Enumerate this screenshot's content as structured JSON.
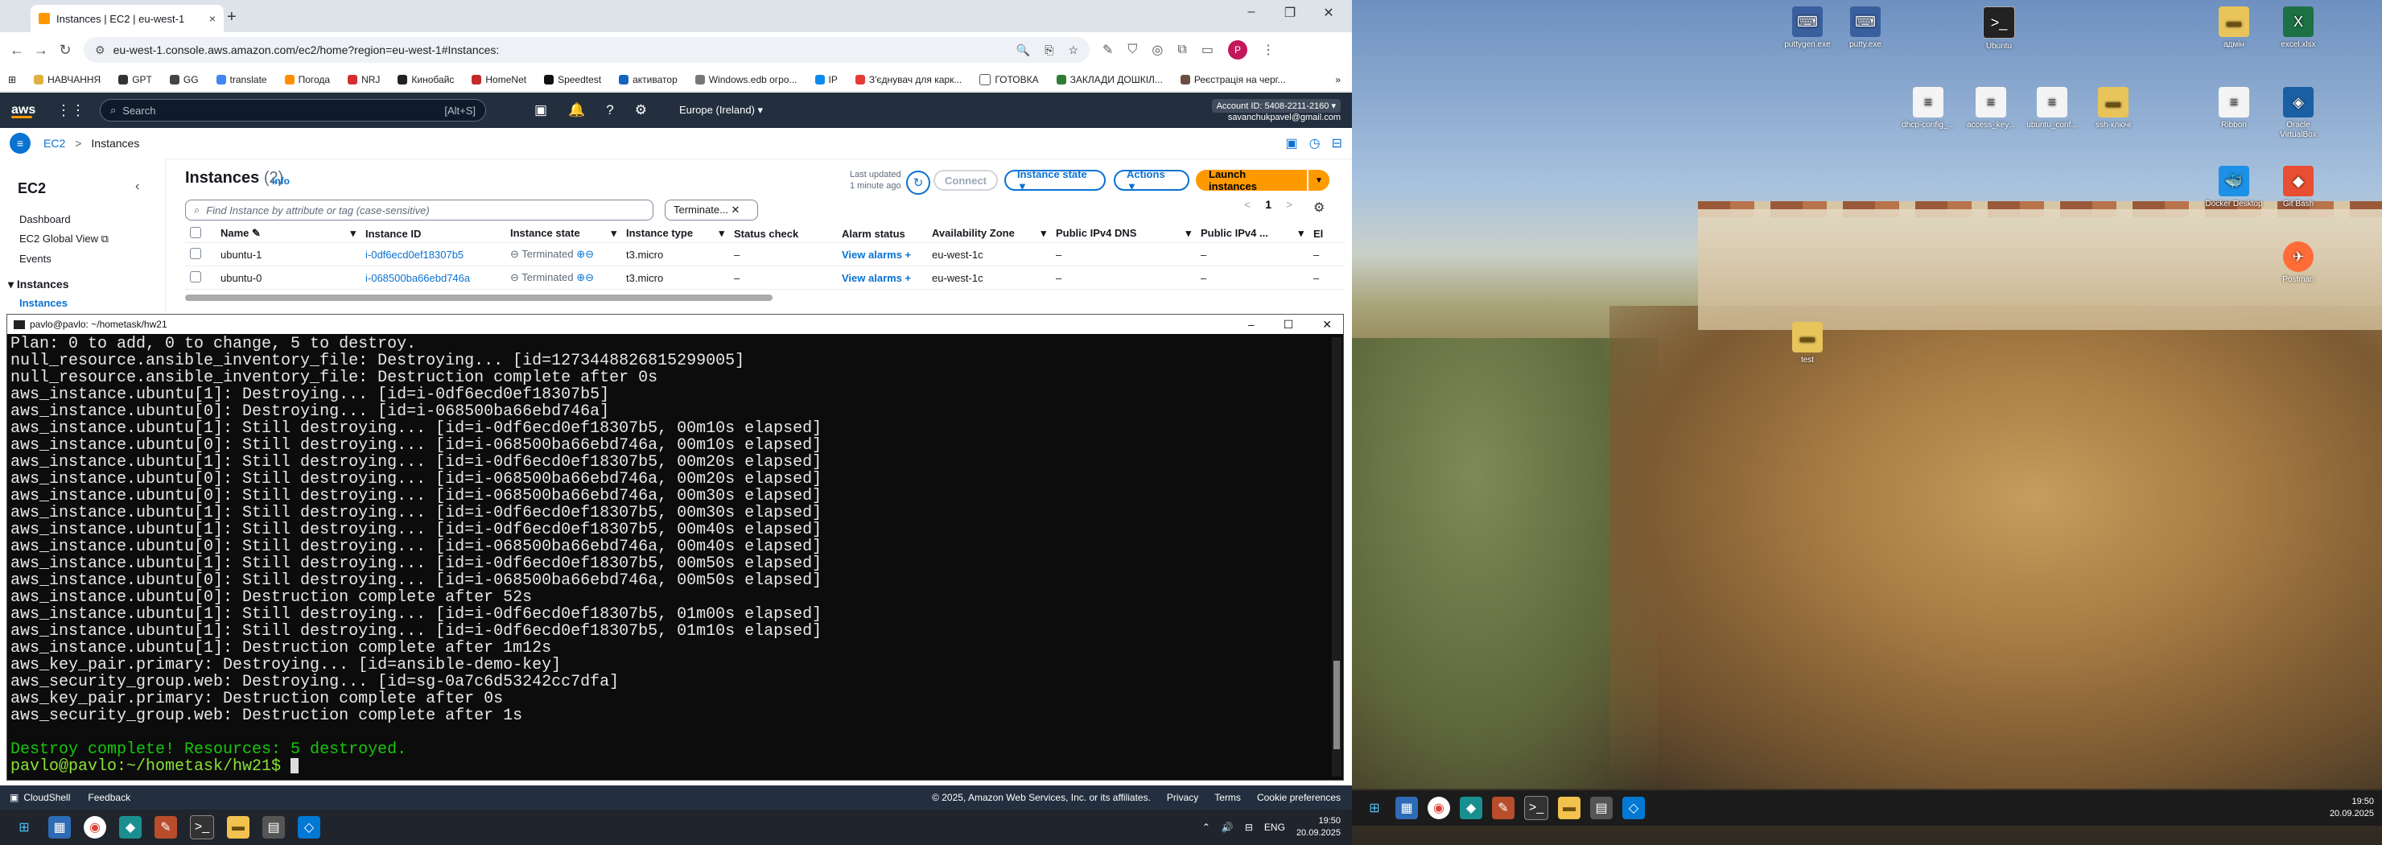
{
  "browser": {
    "tab_title": "Instances | EC2 | eu-west-1",
    "tab_close": "×",
    "new_tab": "+",
    "url": "eu-west-1.console.aws.amazon.com/ec2/home?region=eu-west-1#Instances:",
    "profile_letter": "P",
    "bookmarks": [
      "НАВЧАННЯ",
      "GPT",
      "GG",
      "translate",
      "Погода",
      "NRJ",
      "Кинобайс",
      "HomeNet",
      "Speedtest",
      "активатор",
      "Windows.edb огро...",
      "IP",
      "З'єднувач для карк...",
      "ГОТОВКА",
      "ЗАКЛАДИ ДОШКІЛ...",
      "Реєстрація на черг..."
    ],
    "more_bookmarks": "»"
  },
  "aws": {
    "logo": "aws",
    "search_placeholder": "Search",
    "search_kbd": "[Alt+S]",
    "region": "Europe (Ireland) ▾",
    "account_id": "Account ID: 5408-2211-2160 ▾",
    "account_user": "savanchukpavel@gmail.com",
    "crumb_service": "EC2",
    "crumb_sep": ">",
    "crumb_page": "Instances",
    "sidebar": {
      "title": "EC2",
      "items": [
        "Dashboard",
        "EC2 Global View",
        "Events"
      ],
      "section": "Instances",
      "active": "Instances"
    },
    "panel_title": "Instances",
    "panel_count": "(2)",
    "info": "Info",
    "last_updated": "Last updated",
    "last_updated_value": "1 minute ago",
    "connect": "Connect",
    "instance_state_btn": "Instance state ▼",
    "actions_btn": "Actions ▼",
    "launch_btn": "Launch instances",
    "launch_arrow": "▼",
    "filter_placeholder": "Find Instance by attribute or tag (case-sensitive)",
    "filter_select": "Terminate... ✕",
    "page_prev": "<",
    "page_num": "1",
    "page_next": ">",
    "columns": [
      "Name",
      "Instance ID",
      "Instance state",
      "Instance type",
      "Status check",
      "Alarm status",
      "Availability Zone",
      "Public IPv4 DNS",
      "Public IPv4 ...",
      "El"
    ],
    "rows": [
      {
        "name": "ubuntu-1",
        "id": "i-0df6ecd0ef18307b5",
        "state": "Terminated",
        "type": "t3.micro",
        "status": "–",
        "alarm": "View alarms +",
        "az": "eu-west-1c",
        "dns": "–",
        "ip": "–",
        "el": "–"
      },
      {
        "name": "ubuntu-0",
        "id": "i-068500ba66ebd746a",
        "state": "Terminated",
        "type": "t3.micro",
        "status": "–",
        "alarm": "View alarms +",
        "az": "eu-west-1c",
        "dns": "–",
        "ip": "–",
        "el": "–"
      }
    ],
    "footer_cloudshell": "CloudShell",
    "footer_feedback": "Feedback",
    "footer_copyright": "© 2025, Amazon Web Services, Inc. or its affiliates.",
    "footer_privacy": "Privacy",
    "footer_terms": "Terms",
    "footer_cookies": "Cookie preferences"
  },
  "terminal": {
    "title": "pavlo@pavlo: ~/hometask/hw21",
    "lines": [
      "Plan: 0 to add, 0 to change, 5 to destroy.",
      "null_resource.ansible_inventory_file: Destroying... [id=1273448826815299005]",
      "null_resource.ansible_inventory_file: Destruction complete after 0s",
      "aws_instance.ubuntu[1]: Destroying... [id=i-0df6ecd0ef18307b5]",
      "aws_instance.ubuntu[0]: Destroying... [id=i-068500ba66ebd746a]",
      "aws_instance.ubuntu[1]: Still destroying... [id=i-0df6ecd0ef18307b5, 00m10s elapsed]",
      "aws_instance.ubuntu[0]: Still destroying... [id=i-068500ba66ebd746a, 00m10s elapsed]",
      "aws_instance.ubuntu[1]: Still destroying... [id=i-0df6ecd0ef18307b5, 00m20s elapsed]",
      "aws_instance.ubuntu[0]: Still destroying... [id=i-068500ba66ebd746a, 00m20s elapsed]",
      "aws_instance.ubuntu[0]: Still destroying... [id=i-068500ba66ebd746a, 00m30s elapsed]",
      "aws_instance.ubuntu[1]: Still destroying... [id=i-0df6ecd0ef18307b5, 00m30s elapsed]",
      "aws_instance.ubuntu[1]: Still destroying... [id=i-0df6ecd0ef18307b5, 00m40s elapsed]",
      "aws_instance.ubuntu[0]: Still destroying... [id=i-068500ba66ebd746a, 00m40s elapsed]",
      "aws_instance.ubuntu[1]: Still destroying... [id=i-0df6ecd0ef18307b5, 00m50s elapsed]",
      "aws_instance.ubuntu[0]: Still destroying... [id=i-068500ba66ebd746a, 00m50s elapsed]",
      "aws_instance.ubuntu[0]: Destruction complete after 52s",
      "aws_instance.ubuntu[1]: Still destroying... [id=i-0df6ecd0ef18307b5, 01m00s elapsed]",
      "aws_instance.ubuntu[1]: Still destroying... [id=i-0df6ecd0ef18307b5, 01m10s elapsed]",
      "aws_instance.ubuntu[1]: Destruction complete after 1m12s",
      "aws_key_pair.primary: Destroying... [id=ansible-demo-key]",
      "aws_security_group.web: Destroying... [id=sg-0a7c6d53242cc7dfa]",
      "aws_key_pair.primary: Destruction complete after 0s",
      "aws_security_group.web: Destruction complete after 1s",
      ""
    ],
    "destroy_msg": "Destroy complete! Resources: 5 destroyed.",
    "prompt": "pavlo@pavlo:~/hometask/hw21$ "
  },
  "taskbar_left": {
    "lang": "ENG",
    "time": "19:50",
    "date": "20.09.2025"
  },
  "desktop_icons": [
    {
      "label": "puttygen.exe"
    },
    {
      "label": "putty.exe"
    },
    {
      "label": "Ubuntu"
    },
    {
      "label": "адмін"
    },
    {
      "label": "excel.xlsx"
    },
    {
      "label": "dhcp-config_..."
    },
    {
      "label": "access_key..."
    },
    {
      "label": "ubuntu_conf..."
    },
    {
      "label": "ssh-ключі"
    },
    {
      "label": "Ribbon"
    },
    {
      "label": "Oracle VirtualBox"
    },
    {
      "label": "Docker Desktop"
    },
    {
      "label": "Git Bash"
    },
    {
      "label": "Postman"
    },
    {
      "label": "test"
    }
  ],
  "taskbar_right": {
    "time": "19:50",
    "date": "20.09.2025"
  }
}
